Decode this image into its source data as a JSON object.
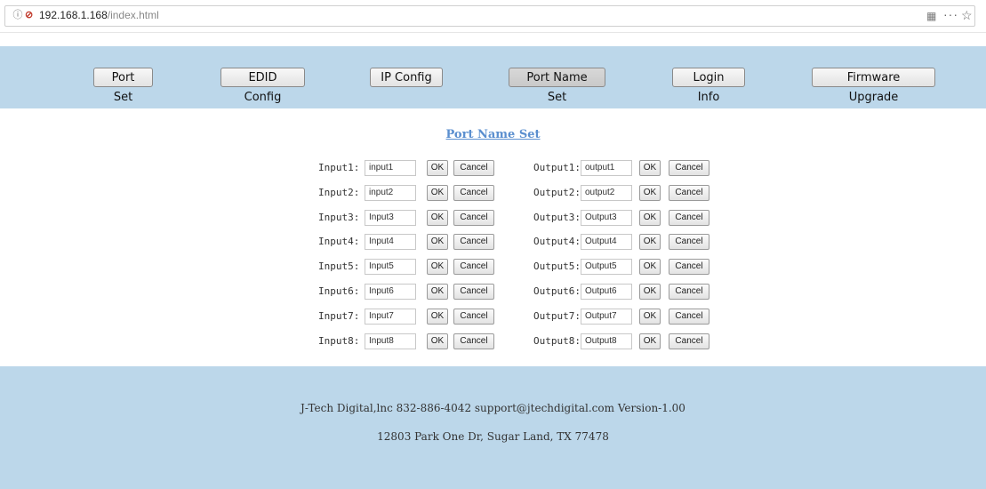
{
  "browser": {
    "url_host": "192.168.1.168",
    "url_path": "/index.html",
    "info_glyph": "ⓘ",
    "insecure_glyph": "🔒",
    "qr_glyph": "▦",
    "more_glyph": "···",
    "star_glyph": "☆"
  },
  "nav": {
    "items": [
      {
        "label": "Port Set"
      },
      {
        "label": "EDID Config"
      },
      {
        "label": "IP Config"
      },
      {
        "label": "Port Name Set",
        "active": true
      },
      {
        "label": "Login Info"
      },
      {
        "label": "Firmware Upgrade"
      }
    ]
  },
  "page_title": "Port Name Set",
  "inputs": [
    {
      "label": "Input1:",
      "value": "input1"
    },
    {
      "label": "Input2:",
      "value": "input2"
    },
    {
      "label": "Input3:",
      "value": "Input3"
    },
    {
      "label": "Input4:",
      "value": "Input4"
    },
    {
      "label": "Input5:",
      "value": "Input5"
    },
    {
      "label": "Input6:",
      "value": "Input6"
    },
    {
      "label": "Input7:",
      "value": "Input7"
    },
    {
      "label": "Input8:",
      "value": "Input8"
    }
  ],
  "outputs": [
    {
      "label": "Output1:",
      "value": "output1"
    },
    {
      "label": "Output2:",
      "value": "output2"
    },
    {
      "label": "Output3:",
      "value": "Output3"
    },
    {
      "label": "Output4:",
      "value": "Output4"
    },
    {
      "label": "Output5:",
      "value": "Output5"
    },
    {
      "label": "Output6:",
      "value": "Output6"
    },
    {
      "label": "Output7:",
      "value": "Output7"
    },
    {
      "label": "Output8:",
      "value": "Output8"
    }
  ],
  "buttons": {
    "ok": "OK",
    "cancel": "Cancel"
  },
  "footer": {
    "line1": "J-Tech Digital,lnc 832-886-4042 support@jtechdigital.com Version-1.00",
    "line2": "12803 Park One Dr, Sugar Land, TX 77478"
  },
  "colors": {
    "band": "#bcd7ea",
    "title_link": "#5b8fcf"
  }
}
